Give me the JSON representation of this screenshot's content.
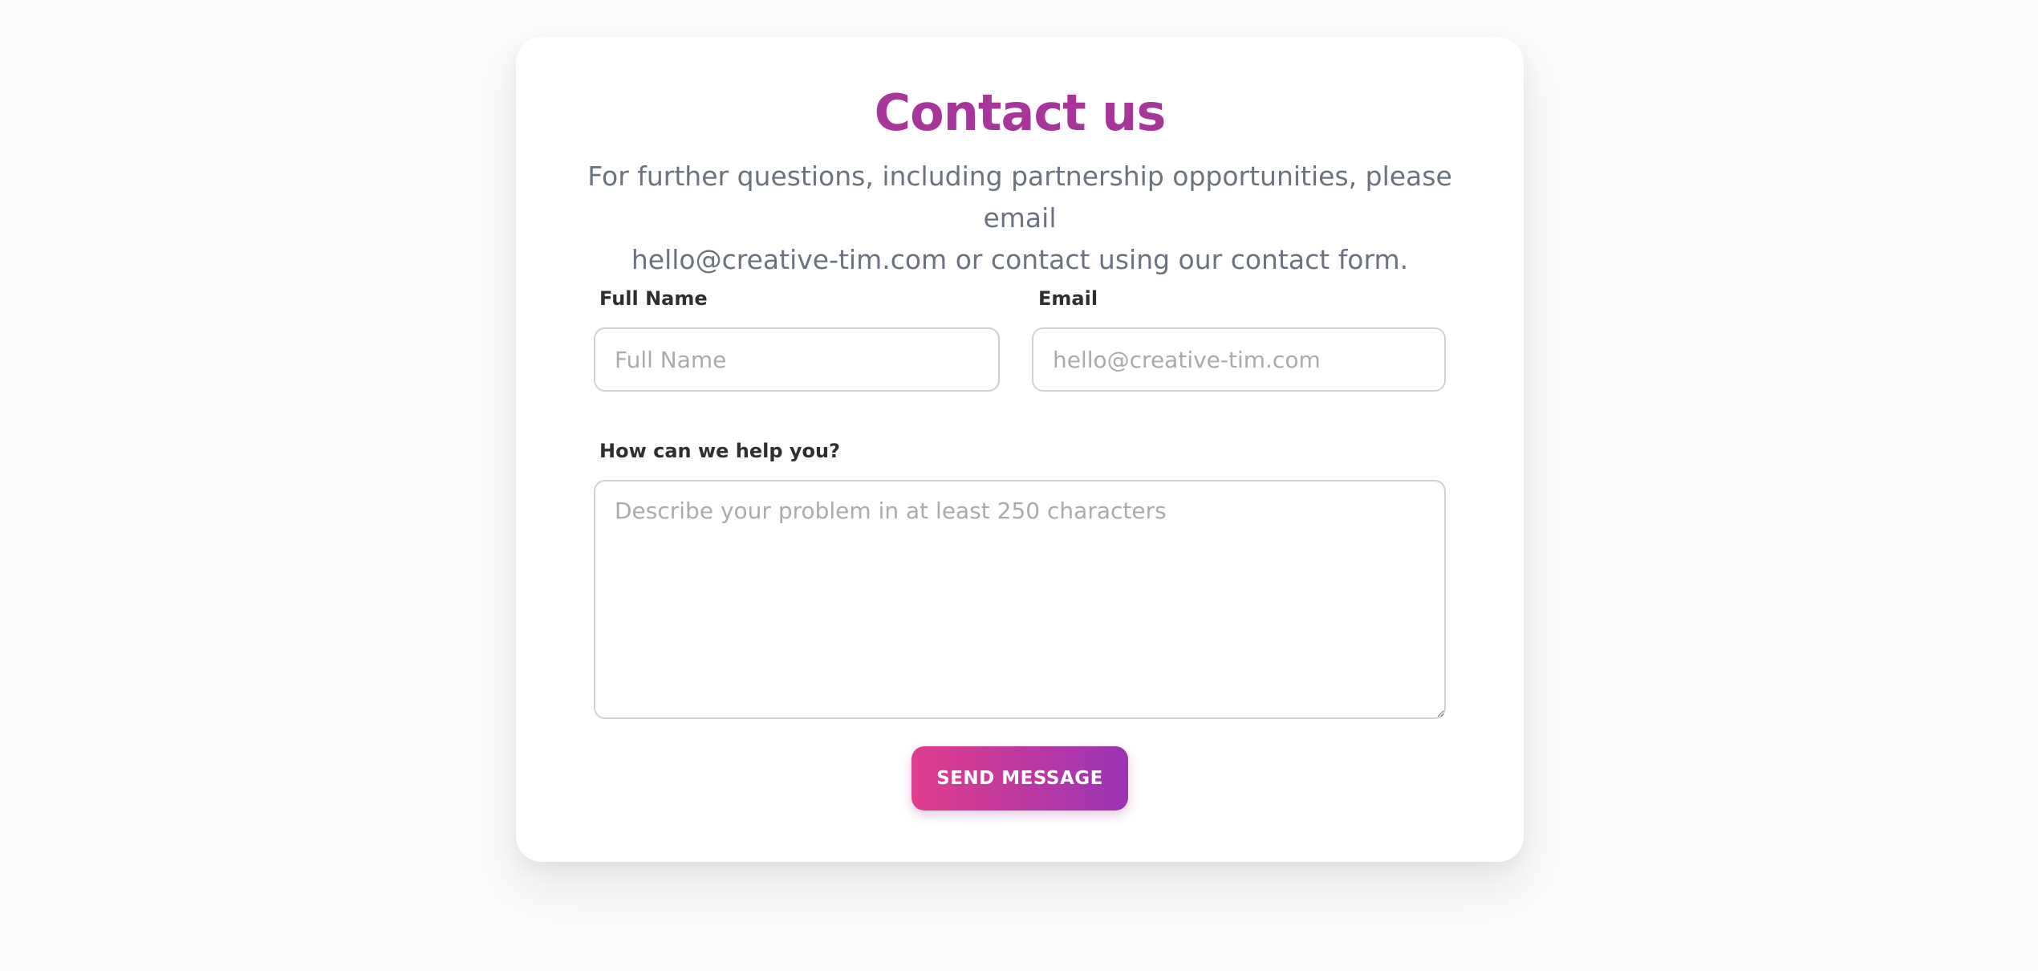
{
  "contact": {
    "title": "Contact us",
    "subtitle_line1": "For further questions, including partnership opportunities, please email",
    "subtitle_line2": "hello@creative-tim.com or contact using our contact form."
  },
  "form": {
    "full_name_label": "Full Name",
    "full_name_placeholder": "Full Name",
    "full_name_value": "",
    "email_label": "Email",
    "email_placeholder": "hello@creative-tim.com",
    "email_value": "",
    "message_label": "How can we help you?",
    "message_placeholder": "Describe your problem in at least 250 characters",
    "message_value": "",
    "submit_label": "SEND MESSAGE"
  },
  "colors": {
    "title": "#a8369a",
    "button_gradient_start": "#e13d8c",
    "button_gradient_end": "#9a34b4"
  }
}
